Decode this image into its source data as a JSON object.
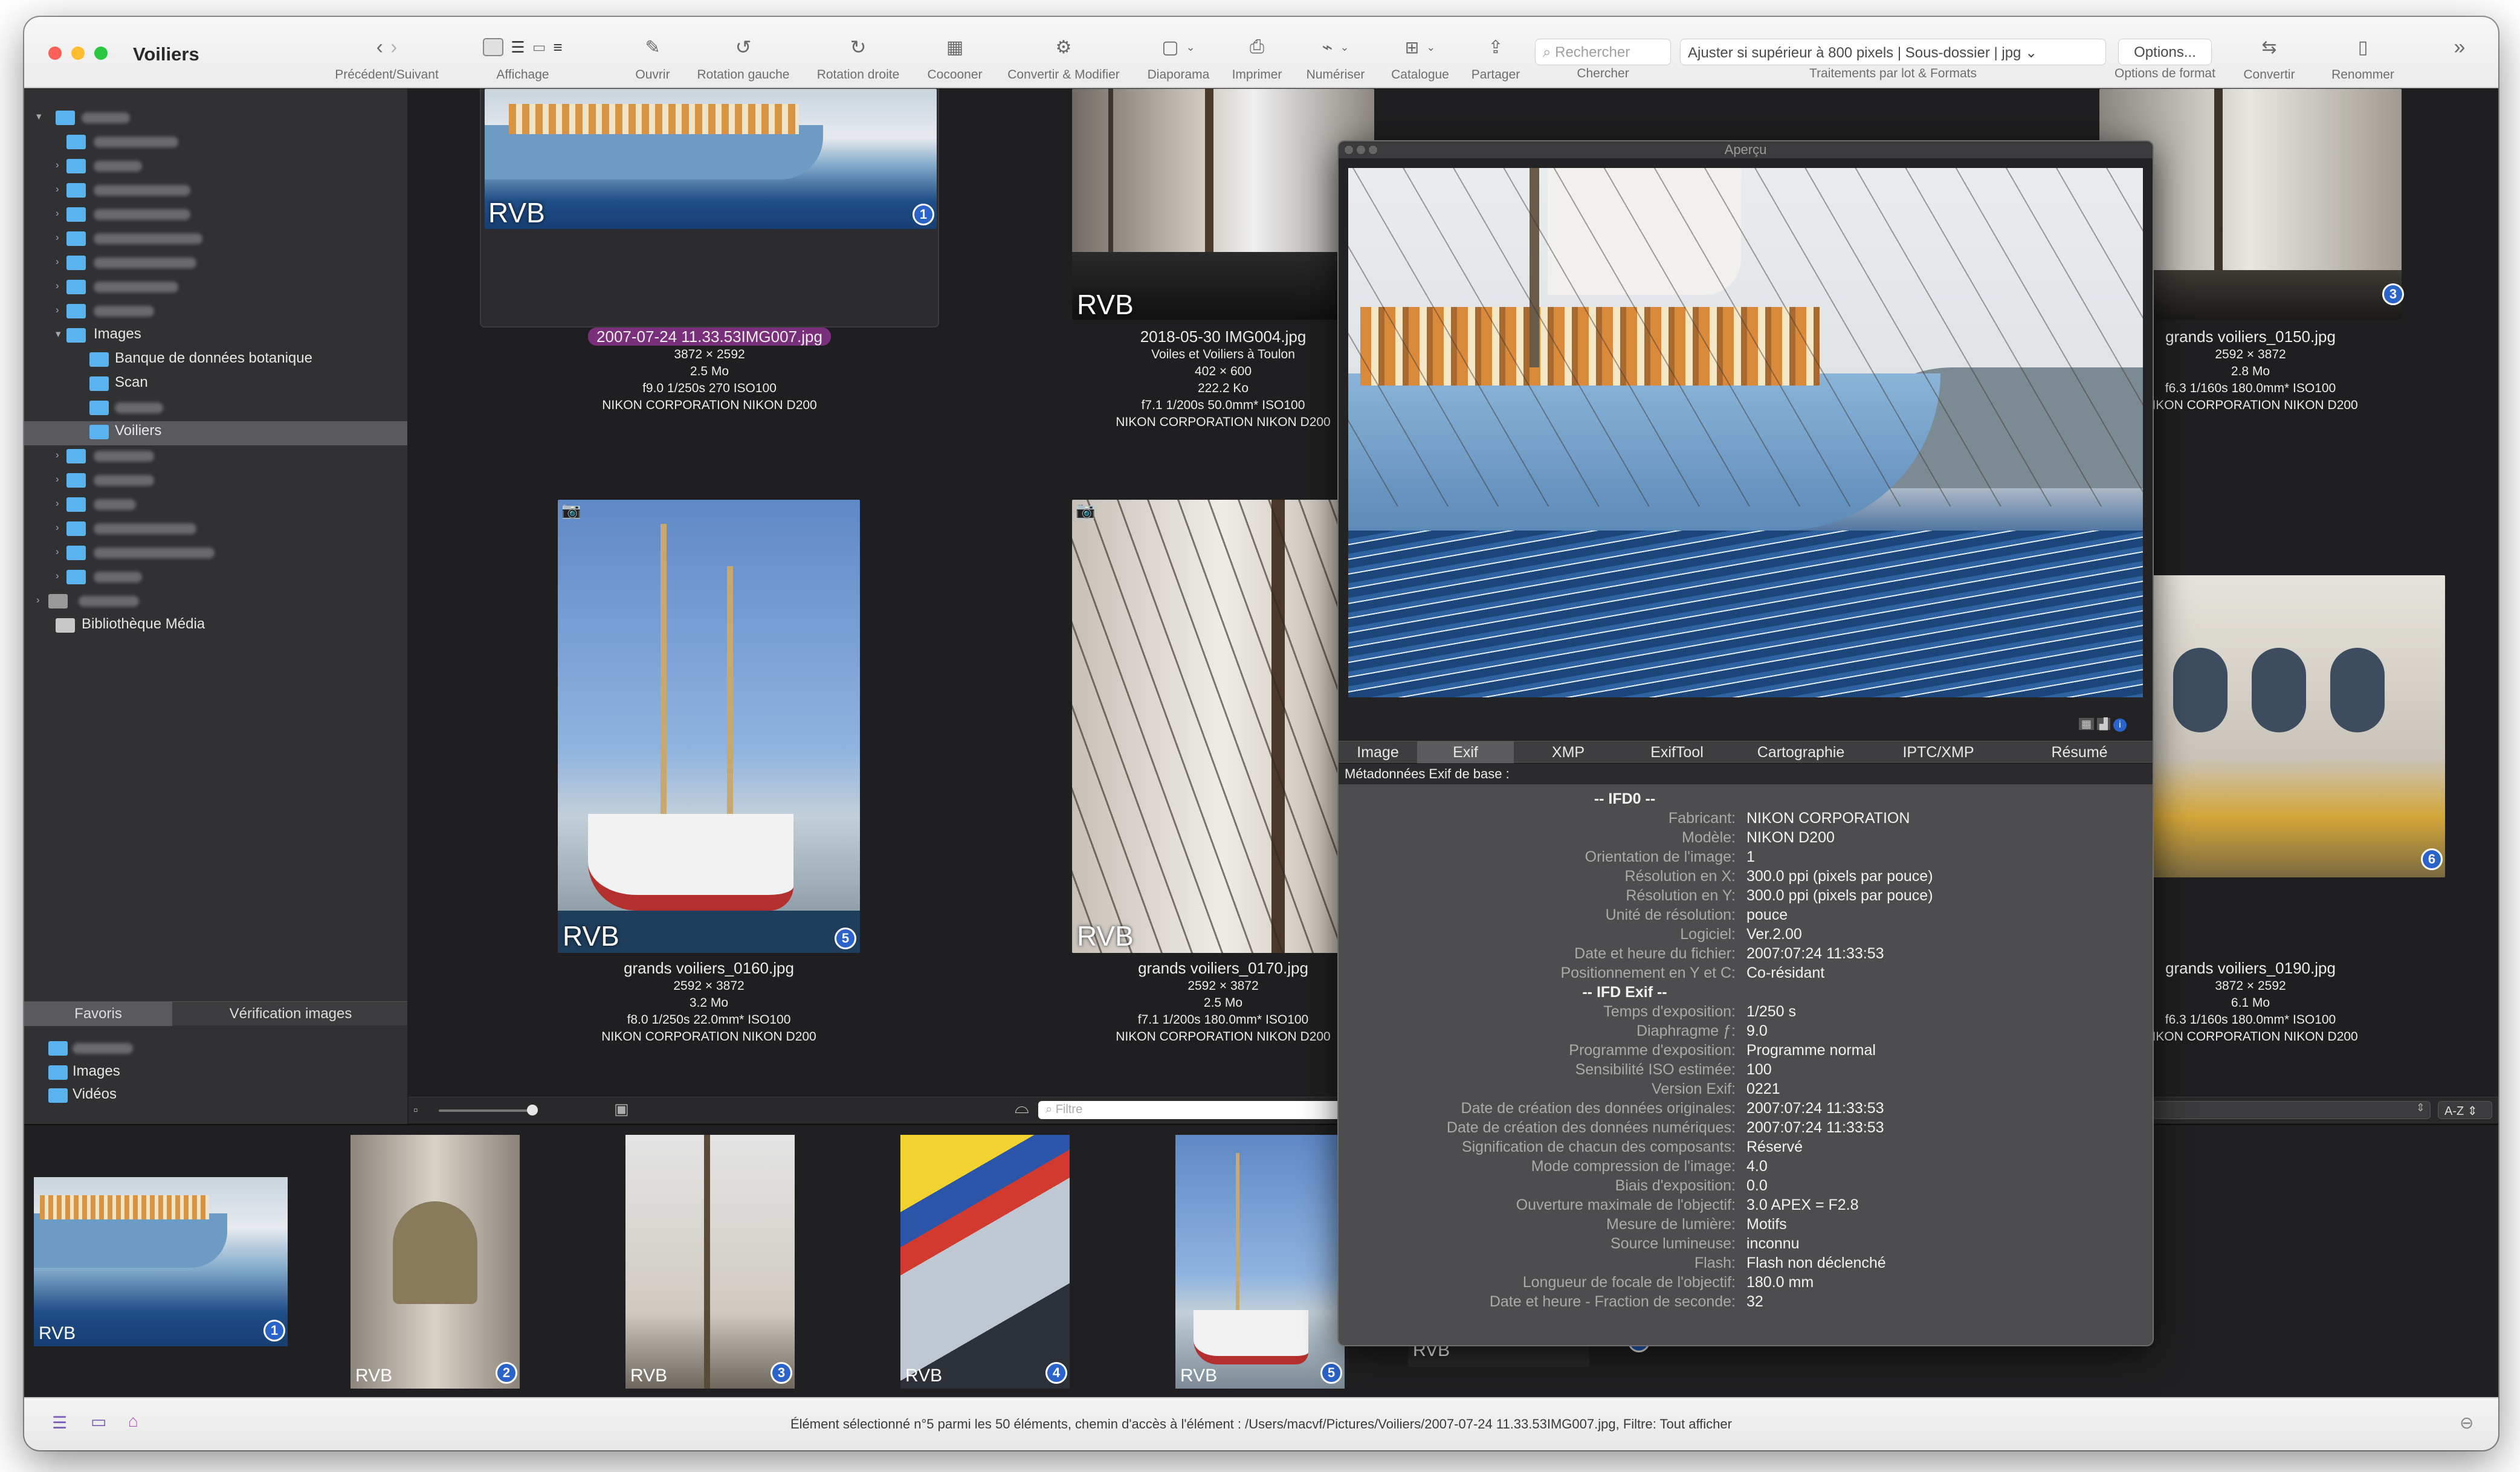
{
  "window": {
    "title": "Voiliers"
  },
  "toolbar": {
    "nav_label": "Précédent/Suivant",
    "affichage_label": "Affichage",
    "ouvrir_label": "Ouvrir",
    "rot_gauche_label": "Rotation gauche",
    "rot_droite_label": "Rotation droite",
    "cocooner_label": "Cocooner",
    "convertir_modifier_label": "Convertir & Modifier",
    "diaporama_label": "Diaporama",
    "imprimer_label": "Imprimer",
    "numeriser_label": "Numériser",
    "catalogue_label": "Catalogue",
    "partager_label": "Partager",
    "search_placeholder": "Rechercher",
    "chercher_label": "Chercher",
    "batch_value": "Ajuster si supérieur à 800 pixels | Sous-dossier | jpg",
    "batch_label": "Traitements par lot & Formats",
    "options_value": "Options...",
    "options_label": "Options de format",
    "convertir_label": "Convertir",
    "renommer_label": "Renommer"
  },
  "sidebar": {
    "images_label": "Images",
    "banque_label": "Banque de données botanique",
    "scan_label": "Scan",
    "voiliers_label": "Voiliers",
    "mediatheque_label": "Bibliothèque Média",
    "tab_favoris": "Favoris",
    "tab_verification": "Vérification images",
    "fav_images": "Images",
    "fav_videos": "Vidéos"
  },
  "grid": [
    {
      "name": "2007-07-24 11.33.53IMG007.jpg",
      "line1": "3872 × 2592",
      "line2": "2.5  Mo",
      "line3": "f9.0 1/250s 270 ISO100",
      "line4": "NIKON CORPORATION NIKON D200",
      "badge": "1",
      "rvb": "RVB"
    },
    {
      "name": "2018-05-30 IMG004.jpg",
      "line0": "Voiles et Voiliers à Toulon",
      "line1": "402 × 600",
      "line2": "222.2 Ko",
      "line3": "f7.1 1/200s 50.0mm* ISO100",
      "line4": "NIKON CORPORATION NIKON D200",
      "rvb": "RVB"
    },
    {
      "name": "grands voiliers_0150.jpg",
      "line1": "2592 × 3872",
      "line2": "2.8  Mo",
      "line3": "f6.3 1/160s 180.0mm* ISO100",
      "line4": "NIKON CORPORATION NIKON D200",
      "badge": "3"
    },
    {
      "name": "grands voiliers_0160.jpg",
      "line1": "2592 × 3872",
      "line2": "3.2  Mo",
      "line3": "f8.0 1/250s 22.0mm* ISO100",
      "line4": "NIKON CORPORATION NIKON D200",
      "badge": "5",
      "rvb": "RVB"
    },
    {
      "name": "grands voiliers_0170.jpg",
      "line1": "2592 × 3872",
      "line2": "2.5  Mo",
      "line3": "f7.1 1/200s 180.0mm* ISO100",
      "line4": "NIKON CORPORATION NIKON D200",
      "rvb": "RVB"
    },
    {
      "name": "grands voiliers_0190.jpg",
      "line1": "3872 × 2592",
      "line2": "6.1  Mo",
      "line3": "f6.3 1/160s 180.0mm* ISO100",
      "line4": "NIKON CORPORATION NIKON D200",
      "badge": "6"
    }
  ],
  "grid_bar": {
    "filter_placeholder": "Filtre",
    "sort_label": "A-Z"
  },
  "strip": [
    {
      "rvb": "RVB",
      "badge": "1"
    },
    {
      "rvb": "RVB",
      "badge": "2"
    },
    {
      "rvb": "RVB",
      "badge": "3"
    },
    {
      "rvb": "RVB",
      "badge": "4"
    },
    {
      "rvb": "RVB",
      "badge": "5"
    },
    {
      "rvb": "RVB",
      "badge": "6"
    }
  ],
  "preview": {
    "title": "Aperçu",
    "tabs": [
      "Image",
      "Exif",
      "XMP",
      "ExifTool",
      "Cartographie",
      "IPTC/XMP",
      "Résumé"
    ],
    "section_label": "Métadonnées Exif de base :",
    "ifd0_header": "-- IFD0 --",
    "exif_header": "-- IFD Exif --",
    "ifd0": [
      {
        "k": "Fabricant:",
        "v": "NIKON CORPORATION"
      },
      {
        "k": "Modèle:",
        "v": "NIKON D200"
      },
      {
        "k": "Orientation de l'image:",
        "v": "1"
      },
      {
        "k": "Résolution en X:",
        "v": "300.0 ppi (pixels par pouce)"
      },
      {
        "k": "Résolution en Y:",
        "v": "300.0 ppi (pixels par pouce)"
      },
      {
        "k": "Unité de résolution:",
        "v": "pouce"
      },
      {
        "k": "Logiciel:",
        "v": "Ver.2.00"
      },
      {
        "k": "Date et heure du fichier:",
        "v": "2007:07:24 11:33:53"
      },
      {
        "k": "Positionnement en Y et C:",
        "v": "Co-résidant"
      }
    ],
    "exif": [
      {
        "k": "Temps d'exposition:",
        "v": "1/250 s"
      },
      {
        "k": "Diaphragme ƒ:",
        "v": "9.0"
      },
      {
        "k": "Programme d'exposition:",
        "v": "Programme normal"
      },
      {
        "k": "Sensibilité ISO estimée:",
        "v": "100"
      },
      {
        "k": "Version Exif:",
        "v": "0221"
      },
      {
        "k": "Date de création des données originales:",
        "v": "2007:07:24 11:33:53"
      },
      {
        "k": "Date de création des données numériques:",
        "v": "2007:07:24 11:33:53"
      },
      {
        "k": "Signification de chacun des composants:",
        "v": "Réservé"
      },
      {
        "k": "Mode compression de l'image:",
        "v": "4.0"
      },
      {
        "k": "Biais d'exposition:",
        "v": "0.0"
      },
      {
        "k": "Ouverture maximale de l'objectif:",
        "v": "3.0 APEX = F2.8"
      },
      {
        "k": "Mesure de lumière:",
        "v": "Motifs"
      },
      {
        "k": "Source lumineuse:",
        "v": "inconnu"
      },
      {
        "k": "Flash:",
        "v": "Flash non déclenché"
      },
      {
        "k": "Longueur de focale de l'objectif:",
        "v": "180.0 mm"
      },
      {
        "k": "Date et heure - Fraction de seconde:",
        "v": "32"
      }
    ]
  },
  "status": {
    "text": "Élément sélectionné n°5 parmi les 50 éléments, chemin d'accès à l'élément : /Users/macvf/Pictures/Voiliers/2007-07-24 11.33.53IMG007.jpg, Filtre: Tout afficher"
  },
  "colors": {
    "selection": "#7a2f7a",
    "badge": "#2a63c9",
    "folder": "#5ab2ee"
  }
}
